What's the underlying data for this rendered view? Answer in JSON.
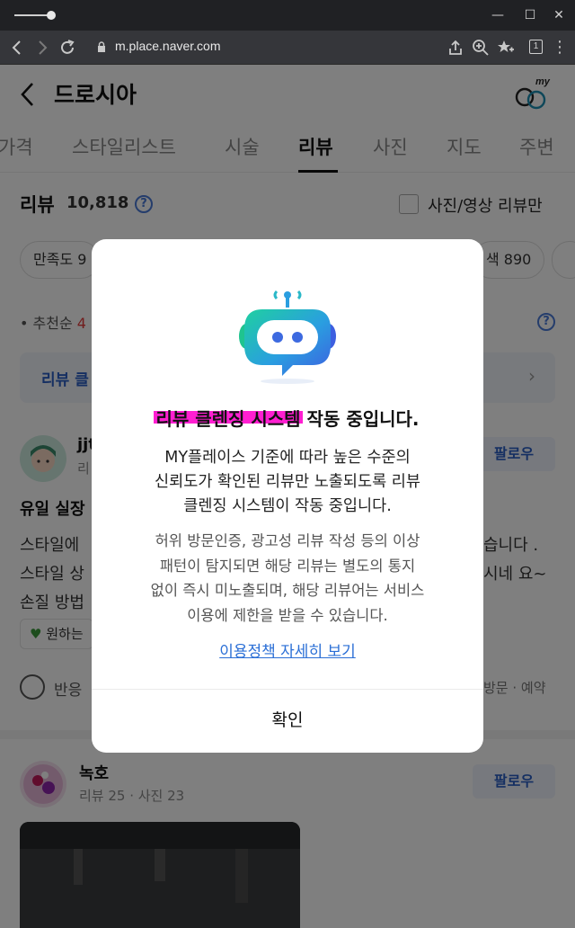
{
  "browser": {
    "url": "m.place.naver.com",
    "tab_count": "1"
  },
  "header": {
    "place_name": "드로시아"
  },
  "tabs": [
    {
      "label": "가격"
    },
    {
      "label": "스타일리스트"
    },
    {
      "label": "시술"
    },
    {
      "label": "리뷰"
    },
    {
      "label": "사진"
    },
    {
      "label": "지도"
    },
    {
      "label": "주변"
    }
  ],
  "reviews_section": {
    "title": "리뷰",
    "count": "10,818",
    "photo_filter_label": "사진/영상 리뷰만",
    "chips": [
      "만족도 9",
      "색 890"
    ],
    "sort_label": "• 추천순",
    "sort_red": "4",
    "cleansys_label": "리뷰 클",
    "rev1": {
      "name": "jjt",
      "sub": "리",
      "follow": "팔로우",
      "title": "유일 실장",
      "lines": [
        "스타일에",
        "스타일 상",
        "손질 방법"
      ],
      "right_fragments": [
        "습니다 .",
        "시네 요~"
      ],
      "keyword": "원하는",
      "react": "반응",
      "visit_meta": "방문 · 예약"
    },
    "rev2": {
      "name": "녹호",
      "sub": "리뷰 25 · 사진 23",
      "follow": "팔로우"
    }
  },
  "modal": {
    "title_highlight": "리뷰 클렌징 시스템",
    "title_rest": " 작동 중입니다.",
    "desc_lines": [
      "MY플레이스 기준에 따라 높은 수준의",
      "신뢰도가 확인된 리뷰만 노출되도록 리뷰",
      "클렌징 시스템이 작동 중입니다."
    ],
    "desc2_lines": [
      "허위 방문인증, 광고성 리뷰 작성 등의 이상",
      "패턴이 탐지되면 해당 리뷰는 별도의 통지",
      "없이 즉시 미노출되며, 해당 리뷰어는 서비스",
      "이용에 제한을 받을 수 있습니다."
    ],
    "policy_link": "이용정책 자세히 보기",
    "confirm": "확인"
  },
  "colors": {
    "highlight": "#ff1fd1",
    "link": "#2b6fd6",
    "accent_blue": "#2b5fc4"
  },
  "icons": [
    "back-arrow-icon",
    "forward-arrow-icon",
    "reload-icon",
    "lock-icon",
    "share-icon",
    "zoom-icon",
    "favorite-icon",
    "menu-icon",
    "chevron-left-icon",
    "my-place-icon",
    "help-icon",
    "checkbox-icon",
    "smile-icon",
    "chevron-right-icon",
    "robot-chat-icon"
  ]
}
